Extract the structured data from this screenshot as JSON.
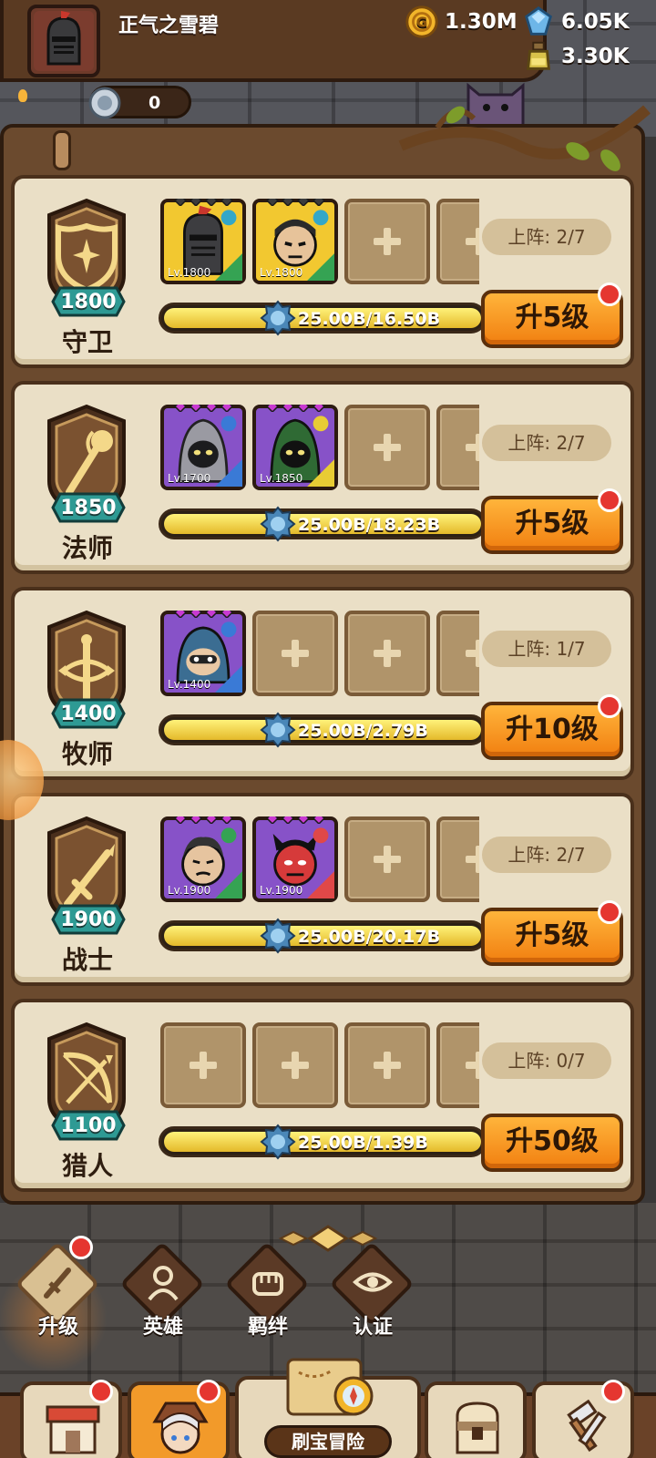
{
  "player": {
    "name": "正气之雪碧",
    "coins": "1.30M",
    "crystals": "6.05K",
    "potions": "3.30K",
    "tokens": "0"
  },
  "classes": [
    {
      "name": "守卫",
      "level": "1800",
      "deploy": "上阵: 2/7",
      "progress_text": "25.00B/16.50B",
      "progress_ratio": 1.0,
      "upgrade_label": "升5级",
      "has_notice": true,
      "emblem": "shield-icon",
      "heroes": [
        {
          "lv": "Lv.1800",
          "star_color": "#3c3c3c",
          "bg": "#f2c830",
          "face": "knight",
          "element_color": "#34a7c8",
          "stat_color": "#35a353"
        },
        {
          "lv": "Lv.1800",
          "star_color": "#3c3c3c",
          "bg": "#f2c830",
          "face": "ninja",
          "element_color": "#34a7c8",
          "stat_color": "#35a353"
        }
      ]
    },
    {
      "name": "法师",
      "level": "1850",
      "deploy": "上阵: 2/7",
      "progress_text": "25.00B/18.23B",
      "progress_ratio": 1.0,
      "upgrade_label": "升5级",
      "has_notice": true,
      "emblem": "staff-icon",
      "heroes": [
        {
          "lv": "Lv.1700",
          "star_color": "#c83ad2",
          "bg": "#8752c8",
          "face": "hood-grey",
          "element_color": "#3a7ad6",
          "stat_color": "#3a7ad6"
        },
        {
          "lv": "Lv.1850",
          "star_color": "#c83ad2",
          "bg": "#8752c8",
          "face": "hood-green",
          "element_color": "#e8cc34",
          "stat_color": "#e8cc34"
        }
      ]
    },
    {
      "name": "牧师",
      "level": "1400",
      "deploy": "上阵: 1/7",
      "progress_text": "25.00B/2.79B",
      "progress_ratio": 1.0,
      "upgrade_label": "升10级",
      "has_notice": true,
      "emblem": "cross-icon",
      "heroes": [
        {
          "lv": "Lv.1400",
          "star_color": "#c83ad2",
          "bg": "#8752c8",
          "face": "hood-blue",
          "element_color": "#3a7ad6",
          "stat_color": "#3a7ad6"
        }
      ]
    },
    {
      "name": "战士",
      "level": "1900",
      "deploy": "上阵: 2/7",
      "progress_text": "25.00B/20.17B",
      "progress_ratio": 1.0,
      "upgrade_label": "升5级",
      "has_notice": true,
      "emblem": "sword-icon",
      "heroes": [
        {
          "lv": "Lv.1900",
          "star_color": "#c83ad2",
          "bg": "#8752c8",
          "face": "man",
          "element_color": "#35a353",
          "stat_color": "#35a353"
        },
        {
          "lv": "Lv.1900",
          "star_color": "#c83ad2",
          "bg": "#8752c8",
          "face": "demon",
          "element_color": "#e04848",
          "stat_color": "#e04848"
        }
      ]
    },
    {
      "name": "猎人",
      "level": "1100",
      "deploy": "上阵: 0/7",
      "progress_text": "25.00B/1.39B",
      "progress_ratio": 1.0,
      "upgrade_label": "升50级",
      "has_notice": false,
      "emblem": "bow-icon",
      "heroes": []
    }
  ],
  "tabs": [
    {
      "label": "升级",
      "icon": "upgrade-sword-icon",
      "active": true,
      "notice": true
    },
    {
      "label": "英雄",
      "icon": "hero-icon",
      "active": false,
      "notice": false
    },
    {
      "label": "羁绊",
      "icon": "bond-fist-icon",
      "active": false,
      "notice": false
    },
    {
      "label": "认证",
      "icon": "eye-icon",
      "active": false,
      "notice": false
    }
  ],
  "nav": {
    "shop_icon": "shop-icon",
    "hero_icon": "hero-portrait-icon",
    "adventure_label": "刷宝冒险",
    "bag_icon": "backpack-icon",
    "forge_icon": "forge-hammer-icon"
  }
}
